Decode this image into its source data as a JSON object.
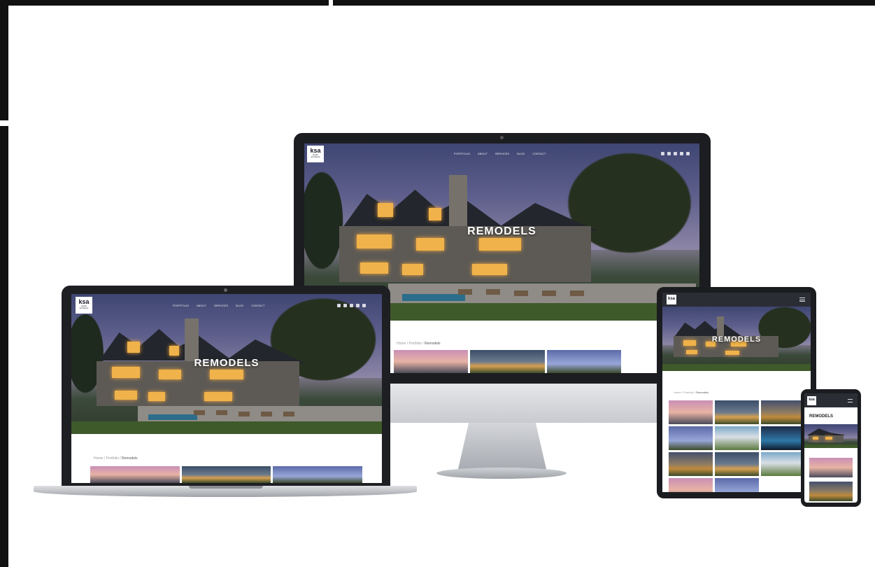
{
  "hero": {
    "title": "REMODELS"
  },
  "nav": {
    "items": [
      "PORTFOLIO",
      "ABOUT",
      "SERVICES",
      "BLOG",
      "CONTACT"
    ]
  },
  "logo": {
    "mark": "ksa",
    "line1": "studio",
    "line2": "architects"
  },
  "breadcrumb": {
    "home": "Home",
    "portfolio": "Portfolio",
    "current": "Remodels"
  },
  "colors": {
    "frame": "#111111",
    "device": "#1c1d20",
    "lawn": "#3e5a2a",
    "window_glow": "#f0b24a"
  },
  "icons": [
    "facebook-icon",
    "twitter-icon",
    "instagram-icon",
    "pinterest-icon",
    "linkedin-icon"
  ]
}
